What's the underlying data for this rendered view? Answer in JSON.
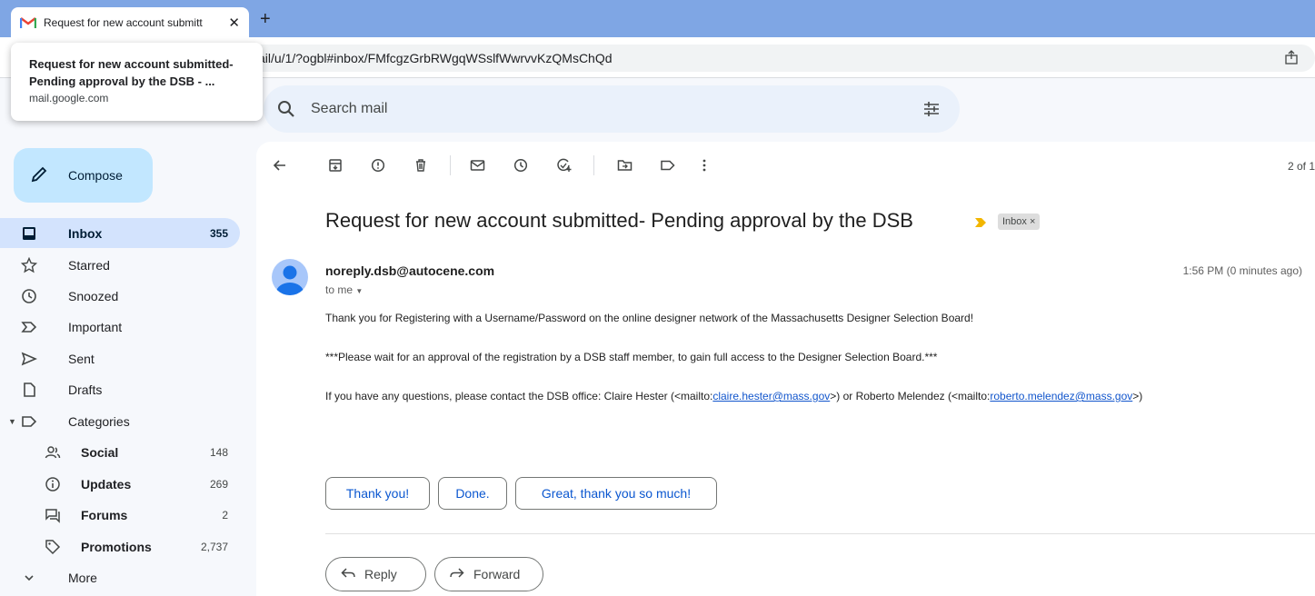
{
  "browser": {
    "tab_title": "Request for new account submitt",
    "new_tab": "+",
    "url": "ail/u/1/?ogbl#inbox/FMfcgzGrbRWgqWSslfWwrvvKzQMsChQd",
    "tooltip_title": "Request for new account submitted- Pending approval by the DSB - ...",
    "tooltip_domain": "mail.google.com"
  },
  "search": {
    "placeholder": "Search mail"
  },
  "compose_label": "Compose",
  "sidebar": {
    "items": [
      {
        "label": "Inbox",
        "count": "355"
      },
      {
        "label": "Starred",
        "count": ""
      },
      {
        "label": "Snoozed",
        "count": ""
      },
      {
        "label": "Important",
        "count": ""
      },
      {
        "label": "Sent",
        "count": ""
      },
      {
        "label": "Drafts",
        "count": ""
      },
      {
        "label": "Categories",
        "count": ""
      },
      {
        "label": "Social",
        "count": "148"
      },
      {
        "label": "Updates",
        "count": "269"
      },
      {
        "label": "Forums",
        "count": "2"
      },
      {
        "label": "Promotions",
        "count": "2,737"
      },
      {
        "label": "More",
        "count": ""
      }
    ]
  },
  "toolbar": {
    "pager": "2 of 1"
  },
  "email": {
    "subject": "Request for new account submitted- Pending approval by the DSB",
    "label_chip": "Inbox ×",
    "sender": "noreply.dsb@autocene.com",
    "time": "1:56 PM (0 minutes ago)",
    "to": "to me",
    "body1": "Thank you for Registering with a Username/Password on the online designer network of the Massachusetts Designer Selection Board!",
    "body2": "***Please wait for an approval of the registration by a DSB staff member, to gain full access to the Designer Selection Board.***",
    "body3_prefix": "If you have any questions, please contact the DSB office: Claire Hester (<mailto:",
    "body3_link1": "claire.hester@mass.gov",
    "body3_mid": ">) or Roberto Melendez (<mailto:",
    "body3_link2": "roberto.melendez@mass.gov",
    "body3_suffix": ">)"
  },
  "smart_replies": [
    "Thank you!",
    "Done.",
    "Great, thank you so much!"
  ],
  "actions": {
    "reply": "Reply",
    "forward": "Forward"
  },
  "colors": {
    "accent": "#0b57d0",
    "compose_bg": "#c2e7ff",
    "active_nav": "#d3e3fd",
    "tabstrip": "#7fa6e4"
  }
}
